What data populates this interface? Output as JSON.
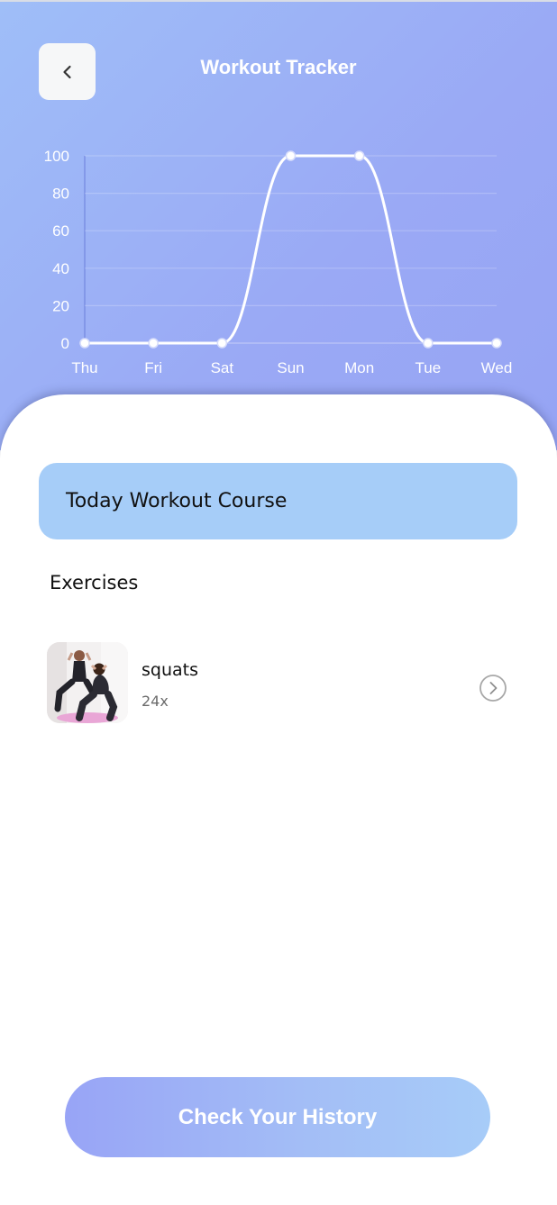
{
  "header": {
    "title": "Workout Tracker",
    "back_icon": "chevron-left-icon"
  },
  "chart_data": {
    "type": "line",
    "categories": [
      "Thu",
      "Fri",
      "Sat",
      "Sun",
      "Mon",
      "Tue",
      "Wed"
    ],
    "values": [
      0,
      0,
      0,
      100,
      100,
      0,
      0
    ],
    "y_ticks": [
      0,
      20,
      40,
      60,
      80,
      100
    ],
    "ylim": [
      0,
      100
    ],
    "title": "",
    "xlabel": "",
    "ylabel": "",
    "grid": true,
    "line_color": "#ffffff",
    "curve": "smooth"
  },
  "course": {
    "label": "Today Workout Course"
  },
  "exercises": {
    "section_title": "Exercises",
    "items": [
      {
        "name": "squats",
        "count": "24x",
        "thumb": "squats-photo",
        "action_icon": "chevron-right-circle-icon"
      }
    ]
  },
  "footer": {
    "history_button_label": "Check Your History"
  },
  "colors": {
    "hero_gradient_start": "#9fbef8",
    "hero_gradient_end": "#96a4f4",
    "course_card": "#a6cdf8",
    "button_gradient_start": "#98a4f6",
    "button_gradient_end": "#a7ccf8"
  }
}
